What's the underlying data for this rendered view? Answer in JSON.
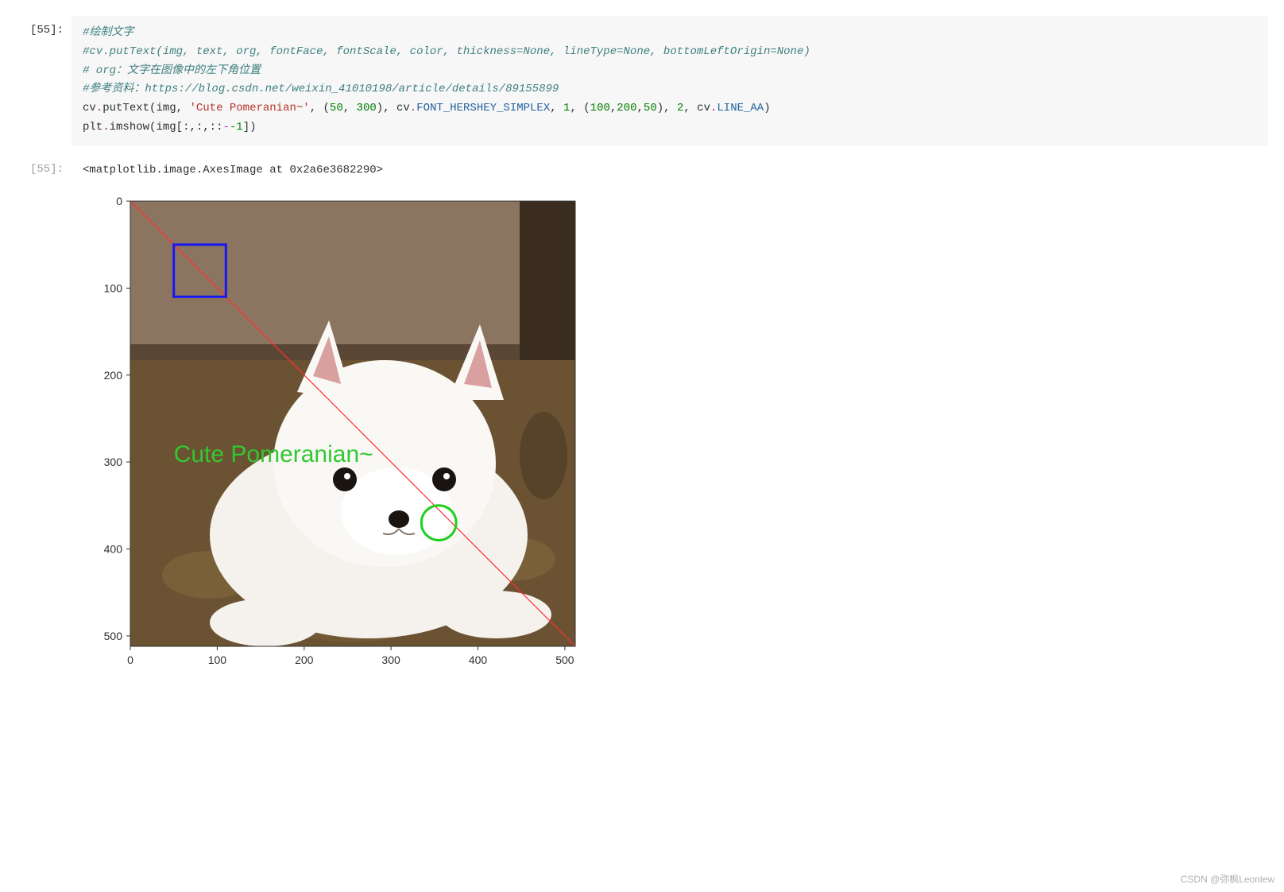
{
  "input_prompt": "[55]:",
  "output_prompt": "[55]:",
  "code": {
    "c1": "#绘制文字",
    "c2": "#cv.putText(img, text, org, fontFace, fontScale, color, thickness=None, lineType=None, bottomLeftOrigin=None)",
    "c3": "# org：文字在图像中的左下角位置",
    "c4": "#参考资料：https://blog.csdn.net/weixin_41010198/article/details/89155899",
    "l5_cv": "cv",
    "l5_putText": "putText",
    "l5_img": "img",
    "l5_str": "'Cute Pomeranian~'",
    "l5_n50": "50",
    "l5_n300": "300",
    "l5_cv2": "cv",
    "l5_const": "FONT_HERSHEY_SIMPLEX",
    "l5_n1": "1",
    "l5_n100": "100",
    "l5_n200": "200",
    "l5_n50b": "50",
    "l5_n2": "2",
    "l5_cv3": "cv",
    "l5_const2": "LINE_AA",
    "l6_plt": "plt",
    "l6_imshow": "imshow",
    "l6_img": "img",
    "l6_neg1": "-1"
  },
  "output_text": "<matplotlib.image.AxesImage at 0x2a6e3682290>",
  "chart_data": {
    "type": "image-with-annotations",
    "x_ticks": [
      "0",
      "100",
      "200",
      "300",
      "400",
      "500"
    ],
    "y_ticks": [
      "0",
      "100",
      "200",
      "300",
      "400",
      "500"
    ],
    "xlim": [
      0,
      512
    ],
    "ylim": [
      512,
      0
    ],
    "image_description": "photo of a white Pomeranian puppy lying on a patterned floor, looking at camera",
    "annotations": {
      "diagonal_line": {
        "from": [
          0,
          0
        ],
        "to": [
          512,
          512
        ],
        "color": "#ff3030"
      },
      "blue_rect": {
        "x": 50,
        "y": 50,
        "w": 60,
        "h": 60,
        "stroke": "#1818f0"
      },
      "green_circle": {
        "cx": 355,
        "cy": 370,
        "r": 20,
        "stroke": "#20d020"
      },
      "text": {
        "content": "Cute Pomeranian~",
        "x": 50,
        "y": 300,
        "color": "#32c832"
      }
    }
  },
  "watermark": "CSDN @弥枫Leonlew"
}
